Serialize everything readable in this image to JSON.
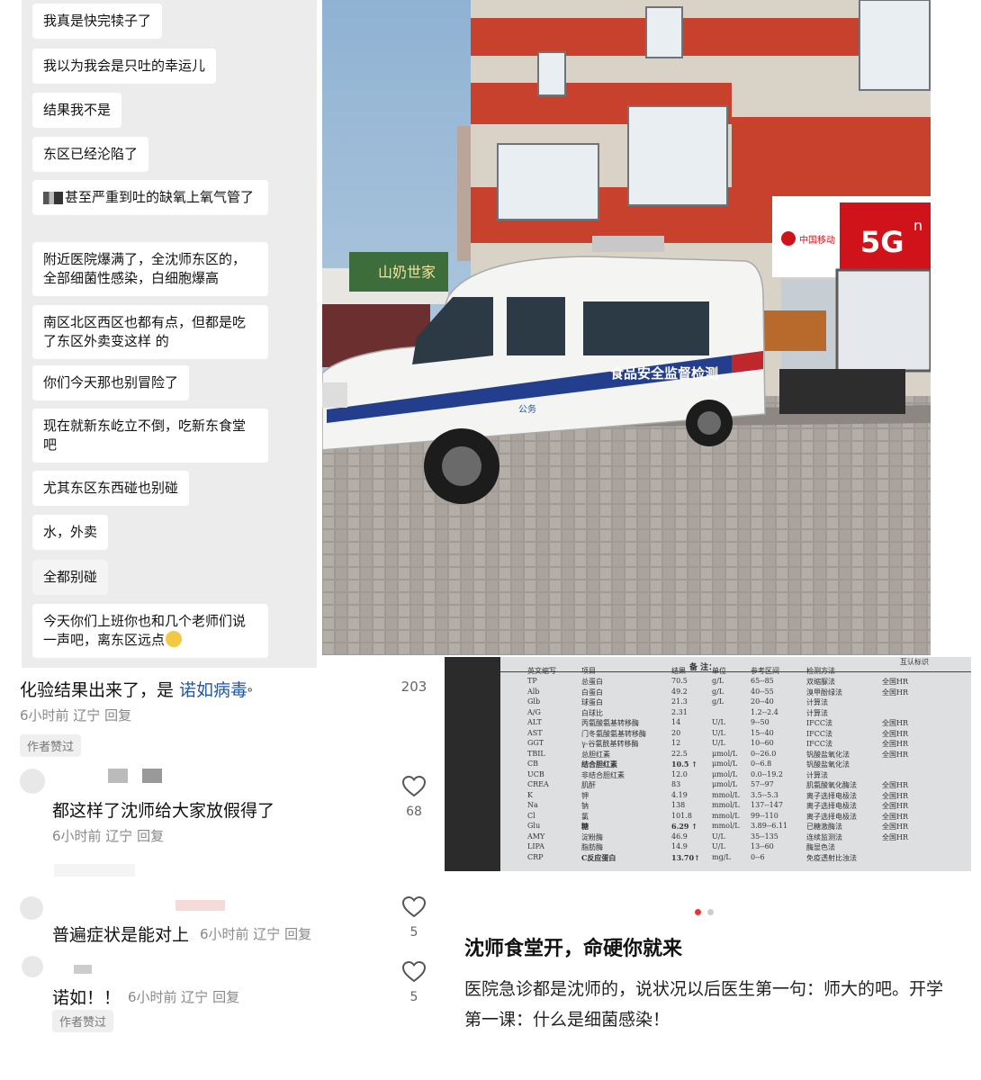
{
  "chat": {
    "messages": [
      "我真是快完犊子了",
      "我以为我会是只吐的幸运儿",
      "结果我不是",
      "东区已经沦陷了",
      "甚至严重到吐的缺氧上氧气管了",
      "附近医院爆满了，全沈师东区的，全部细菌性感染，白细胞爆高",
      "南区北区西区也都有点，但都是吃了东区外卖变这样 的",
      "你们今天那也别冒险了",
      "现在就新东屹立不倒，吃新东食堂吧",
      "尤其东区东西碰也别碰",
      "水，外卖",
      "全都别碰",
      "今天你们上班你也和几个老师们说一声吧，离东区远点"
    ]
  },
  "photo": {
    "van_text": "食品安全监督检测",
    "store_sign": "5G",
    "store_sup": "n",
    "store_brand": "中国移动",
    "shop_sign": "山奶世家",
    "van_badge": "公务"
  },
  "comments": {
    "top": {
      "text_prefix": "化验结果出来了，是 ",
      "text_link": "诺如病毒",
      "text_suffix": "ᵒ",
      "meta": "6小时前 辽宁 回复",
      "likes": "203",
      "tag": "作者赞过"
    },
    "items": [
      {
        "text": "都这样了沈师给大家放假得了",
        "meta": "6小时前 辽宁 回复",
        "likes": "68"
      },
      {
        "text": "普遍症状是能对上",
        "meta": "6小时前 辽宁 回复",
        "likes": "5"
      },
      {
        "text": "诺如！！",
        "meta": "6小时前 辽宁 回复",
        "likes": "5",
        "tag": "作者赞过"
      }
    ]
  },
  "report": {
    "header": [
      "英文缩写",
      "项目",
      "结果",
      "单位",
      "参考区间",
      "检测方法"
    ],
    "rows": [
      [
        "TP",
        "总蛋白",
        "70.5",
        "g/L",
        "65--85",
        "双缩脲法",
        "全国HR"
      ],
      [
        "Alb",
        "白蛋白",
        "49.2",
        "g/L",
        "40--55",
        "溴甲酚绿法",
        "全国HR"
      ],
      [
        "Glb",
        "球蛋白",
        "21.3",
        "g/L",
        "20--40",
        "计算法",
        ""
      ],
      [
        "A/G",
        "白球比",
        "2.31",
        "",
        "1.2--2.4",
        "计算法",
        ""
      ],
      [
        "ALT",
        "丙氨酸氨基转移酶",
        "14",
        "U/L",
        "9--50",
        "IFCC法",
        "全国HR"
      ],
      [
        "AST",
        "门冬氨酸氨基转移酶",
        "20",
        "U/L",
        "15--40",
        "IFCC法",
        "全国HR"
      ],
      [
        "GGT",
        "γ-谷氨酰基转移酶",
        "12",
        "U/L",
        "10--60",
        "IFCC法",
        "全国HR"
      ],
      [
        "TBIL",
        "总胆红素",
        "22.5",
        "μmol/L",
        "0--26.0",
        "钒酸盐氧化法",
        "全国HR"
      ],
      [
        "CB",
        "结合胆红素",
        "10.5 ↑",
        "μmol/L",
        "0--6.8",
        "钒酸盐氧化法",
        ""
      ],
      [
        "UCB",
        "非结合胆红素",
        "12.0",
        "μmol/L",
        "0.0--19.2",
        "计算法",
        ""
      ],
      [
        "CREA",
        "肌酐",
        "83",
        "μmol/L",
        "57--97",
        "肌氨酸氧化酶法",
        "全国HR"
      ],
      [
        "K",
        "钾",
        "4.19",
        "mmol/L",
        "3.5--5.3",
        "离子选择电极法",
        "全国HR"
      ],
      [
        "Na",
        "钠",
        "138",
        "mmol/L",
        "137--147",
        "离子选择电极法",
        "全国HR"
      ],
      [
        "Cl",
        "氯",
        "101.8",
        "mmol/L",
        "99--110",
        "离子选择电极法",
        "全国HR"
      ],
      [
        "Glu",
        "糖",
        "6.29 ↑",
        "mmol/L",
        "3.89--6.11",
        "已糖激酶法",
        "全国HR"
      ],
      [
        "AMY",
        "淀粉酶",
        "46.9",
        "U/L",
        "35--135",
        "连续监测法",
        "全国HR"
      ],
      [
        "LIPA",
        "脂肪酶",
        "14.9",
        "U/L",
        "13--60",
        "酶显色法",
        ""
      ],
      [
        "CRP",
        "C反应蛋白",
        "13.70↑",
        "mg/L",
        "0--6",
        "免疫透射比浊法",
        ""
      ]
    ],
    "note": "备 注：",
    "right_col_header": "互认标识"
  },
  "post": {
    "title": "沈师食堂开，命硬你就来",
    "body": "医院急诊都是沈师的，说状况以后医生第一句：师大的吧。开学第一课：什么是细菌感染！"
  },
  "colors": {
    "link": "#1f56a8",
    "wall_red": "#c8412c",
    "mobile_red": "#d0121b"
  }
}
